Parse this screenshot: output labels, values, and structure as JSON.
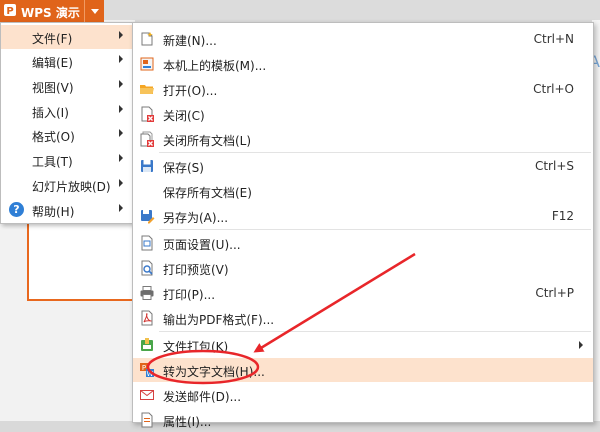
{
  "app": {
    "title": "WPS 演示"
  },
  "primary_menu": {
    "items": [
      {
        "label": "文件(F)",
        "has_submenu": true,
        "active": true
      },
      {
        "label": "编辑(E)",
        "has_submenu": true
      },
      {
        "label": "视图(V)",
        "has_submenu": true
      },
      {
        "label": "插入(I)",
        "has_submenu": true
      },
      {
        "label": "格式(O)",
        "has_submenu": true
      },
      {
        "label": "工具(T)",
        "has_submenu": true
      },
      {
        "label": "幻灯片放映(D)",
        "has_submenu": true
      },
      {
        "label": "帮助(H)",
        "has_submenu": true,
        "icon": "help-icon"
      }
    ]
  },
  "file_menu": {
    "items": [
      {
        "label": "新建(N)...",
        "shortcut": "Ctrl+N",
        "icon": "new-file-icon"
      },
      {
        "label": "本机上的模板(M)...",
        "shortcut": "",
        "icon": "template-icon"
      },
      {
        "label": "打开(O)...",
        "shortcut": "Ctrl+O",
        "icon": "open-folder-icon"
      },
      {
        "label": "关闭(C)",
        "shortcut": "",
        "icon": "close-doc-icon"
      },
      {
        "label": "关闭所有文档(L)",
        "shortcut": "",
        "icon": "close-all-icon"
      },
      {
        "label": "保存(S)",
        "shortcut": "Ctrl+S",
        "icon": "save-icon"
      },
      {
        "label": "保存所有文档(E)",
        "shortcut": "",
        "icon": ""
      },
      {
        "label": "另存为(A)...",
        "shortcut": "F12",
        "icon": "save-as-icon"
      },
      {
        "label": "页面设置(U)...",
        "shortcut": "",
        "icon": "page-setup-icon"
      },
      {
        "label": "打印预览(V)",
        "shortcut": "",
        "icon": "print-preview-icon"
      },
      {
        "label": "打印(P)...",
        "shortcut": "Ctrl+P",
        "icon": "printer-icon"
      },
      {
        "label": "输出为PDF格式(F)...",
        "shortcut": "",
        "icon": "pdf-icon"
      },
      {
        "label": "文件打包(K)",
        "shortcut": "",
        "icon": "package-icon",
        "has_submenu": true
      },
      {
        "label": "转为文字文档(H)...",
        "shortcut": "",
        "icon": "convert-to-text-icon",
        "highlighted": true
      },
      {
        "label": "发送邮件(D)...",
        "shortcut": "",
        "icon": "mail-icon"
      },
      {
        "label": "属性(I)...",
        "shortcut": "",
        "icon": "properties-icon"
      }
    ]
  },
  "annotation": {
    "color": "#e8262a"
  },
  "colors": {
    "accent": "#e0641a",
    "menu_highlight": "#fde2cd"
  }
}
